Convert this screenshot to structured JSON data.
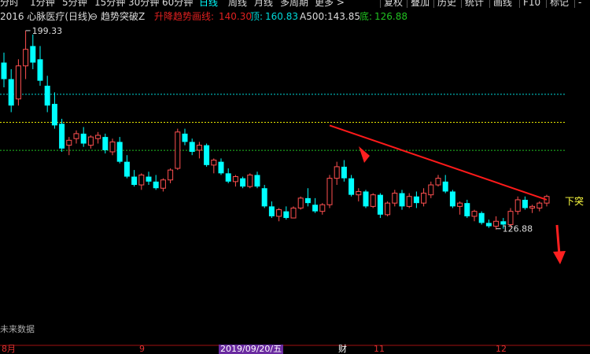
{
  "toolbar": {
    "left_items": [
      "分时",
      "1分钟",
      "5分钟",
      "15分钟",
      "30分钟",
      "60分钟",
      "日线",
      "周线",
      "月线",
      "多周期",
      "更多 >"
    ],
    "active": "日线",
    "right_items": [
      "复权",
      "叠加",
      "历史",
      "统计",
      "画线",
      "F10",
      "标记",
      "-"
    ]
  },
  "info": {
    "code_name": "2016 心脉医疗(日线)",
    "indicator": "趋势突破Z",
    "line_label": "升降趋势画线:",
    "line_value": "140.30",
    "top_label": "顶:",
    "top_value": "160.83",
    "a500_label": "A500:",
    "a500_value": "143.85",
    "bottom_label": "底:",
    "bottom_value": "126.88"
  },
  "annotations": {
    "high_label": "199.33",
    "low_label": "126.88",
    "break_label": "下突",
    "future_label": "未来数据"
  },
  "axis": {
    "labels": [
      "8月",
      "9",
      "2019/09/20/五",
      "财",
      "11",
      "12"
    ]
  },
  "colors": {
    "up": "#ff5050",
    "down": "#00ffff",
    "trendline": "#ff1a1a",
    "top_line": "#00d8d8",
    "mid_line": "#e8e800",
    "bottom_line": "#20c020",
    "active_tab": "#00ffff"
  },
  "chart_data": {
    "type": "candlestick",
    "ohlc": [
      [
        180,
        186,
        165,
        170
      ],
      [
        170,
        176,
        150,
        154
      ],
      [
        158,
        182,
        154,
        178
      ],
      [
        178,
        199.33,
        170,
        188
      ],
      [
        190,
        197,
        176,
        180
      ],
      [
        182,
        190,
        166,
        169
      ],
      [
        166,
        172,
        150,
        154
      ],
      [
        155,
        162,
        140,
        142
      ],
      [
        143,
        146,
        126,
        128
      ],
      [
        130,
        135,
        124,
        133
      ],
      [
        134,
        139,
        131,
        137
      ],
      [
        137,
        141,
        129,
        131
      ],
      [
        130,
        136,
        128,
        135
      ],
      [
        134,
        138,
        131,
        136
      ],
      [
        135,
        137,
        125,
        127
      ],
      [
        126,
        134,
        124,
        132
      ],
      [
        132,
        135,
        119,
        120
      ],
      [
        120,
        124,
        110,
        111
      ],
      [
        111,
        115,
        105,
        106
      ],
      [
        106,
        113,
        103,
        112
      ],
      [
        111,
        114,
        106,
        108
      ],
      [
        108,
        112,
        103,
        104
      ],
      [
        104,
        110,
        102,
        109
      ],
      [
        109,
        116,
        107,
        115
      ],
      [
        116,
        140,
        115,
        138
      ],
      [
        137,
        140,
        130,
        132
      ],
      [
        132,
        134,
        124,
        126
      ],
      [
        127,
        132,
        122,
        130
      ],
      [
        130,
        131,
        117,
        118
      ],
      [
        118,
        122,
        113,
        121
      ],
      [
        120,
        122,
        112,
        113
      ],
      [
        113,
        116,
        107,
        108
      ],
      [
        108,
        112,
        105,
        111
      ],
      [
        110,
        111,
        104,
        105
      ],
      [
        105,
        113,
        104,
        112
      ],
      [
        112,
        114,
        104,
        105
      ],
      [
        104,
        106,
        92,
        93
      ],
      [
        93,
        96,
        86,
        87
      ],
      [
        87,
        92,
        84,
        91
      ],
      [
        90,
        93,
        85,
        86
      ],
      [
        86,
        93,
        86,
        92
      ],
      [
        92,
        99,
        91,
        98
      ],
      [
        98,
        104,
        93,
        95
      ],
      [
        94,
        98,
        89,
        90
      ],
      [
        90,
        95,
        88,
        94
      ],
      [
        94,
        112,
        92,
        110
      ],
      [
        110,
        120,
        106,
        117
      ],
      [
        117,
        121,
        108,
        110
      ],
      [
        110,
        112,
        99,
        100
      ],
      [
        100,
        104,
        96,
        102
      ],
      [
        102,
        103,
        92,
        93
      ],
      [
        93,
        101,
        92,
        100
      ],
      [
        100,
        101,
        86,
        88
      ],
      [
        88,
        96,
        87,
        95
      ],
      [
        95,
        103,
        93,
        101
      ],
      [
        101,
        103,
        91,
        93
      ],
      [
        93,
        101,
        92,
        99
      ],
      [
        99,
        102,
        92,
        95
      ],
      [
        95,
        104,
        93,
        101
      ],
      [
        100,
        108,
        98,
        106
      ],
      [
        106,
        112,
        105,
        110
      ],
      [
        108,
        112,
        101,
        102
      ],
      [
        102,
        103,
        92,
        93
      ],
      [
        93,
        96,
        88,
        95
      ],
      [
        95,
        97,
        86,
        87
      ],
      [
        87,
        91,
        84,
        90
      ],
      [
        89,
        90,
        82,
        83
      ],
      [
        83,
        85,
        80,
        81
      ],
      [
        81,
        87,
        79,
        84
      ],
      [
        84,
        86,
        79.5,
        82
      ],
      [
        82,
        92,
        80,
        90
      ],
      [
        90,
        99,
        88,
        97
      ],
      [
        97,
        99,
        91,
        92
      ],
      [
        92,
        94,
        89,
        93
      ],
      [
        92,
        96,
        90,
        95
      ],
      [
        95,
        100,
        93,
        99
      ]
    ],
    "levels": {
      "top": 160.83,
      "a500": 143.85,
      "bottom": 126.88
    },
    "trendline_from": 142,
    "trendline_to": 97
  }
}
